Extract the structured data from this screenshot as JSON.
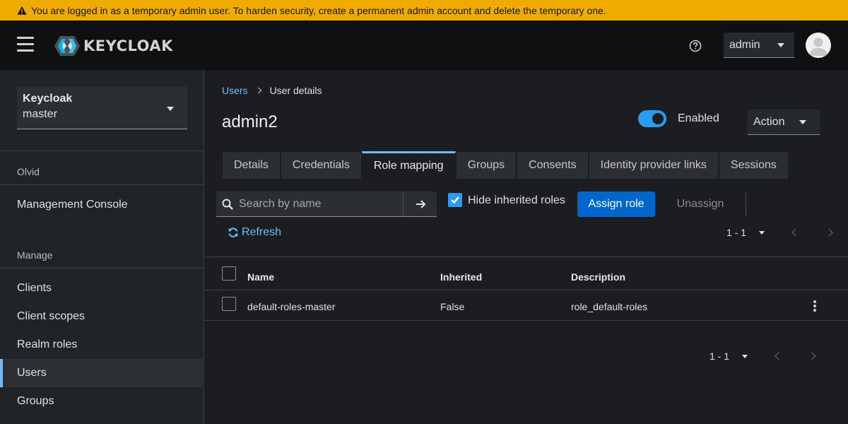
{
  "banner": {
    "text": "You are logged in as a temporary admin user. To harden security, create a permanent admin account and delete the temporary one.",
    "icon": "warning-icon",
    "color": "#f0ab00"
  },
  "masthead": {
    "logo_text": "KEYCLOAK",
    "user": "admin"
  },
  "sidebar": {
    "realm": {
      "name": "Keycloak",
      "sub": "master"
    },
    "group1": "Olvid",
    "item_console": "Management Console",
    "group2": "Manage",
    "items": [
      "Clients",
      "Client scopes",
      "Realm roles",
      "Users",
      "Groups"
    ],
    "active_item": "Users"
  },
  "main": {
    "breadcrumb": {
      "link": "Users",
      "current": "User details"
    },
    "title": "admin2",
    "enabled_label": "Enabled",
    "enabled": true,
    "action_label": "Action",
    "tabs": [
      "Details",
      "Credentials",
      "Role mapping",
      "Groups",
      "Consents",
      "Identity provider links",
      "Sessions"
    ],
    "active_tab": "Role mapping",
    "toolbar": {
      "search_placeholder": "Search by name",
      "hide_inherited_label": "Hide inherited roles",
      "hide_inherited_checked": true,
      "assign_label": "Assign role",
      "unassign_label": "Unassign",
      "refresh_label": "Refresh"
    },
    "pagination": {
      "range": "1 - 1"
    },
    "table": {
      "columns": [
        "Name",
        "Inherited",
        "Description"
      ],
      "rows": [
        {
          "name": "default-roles-master",
          "inherited": "False",
          "description": "role_default-roles"
        }
      ]
    }
  },
  "colors": {
    "accent": "#73bcf7",
    "primary_button": "#0066cc",
    "toggle_on": "#2b9af3"
  }
}
